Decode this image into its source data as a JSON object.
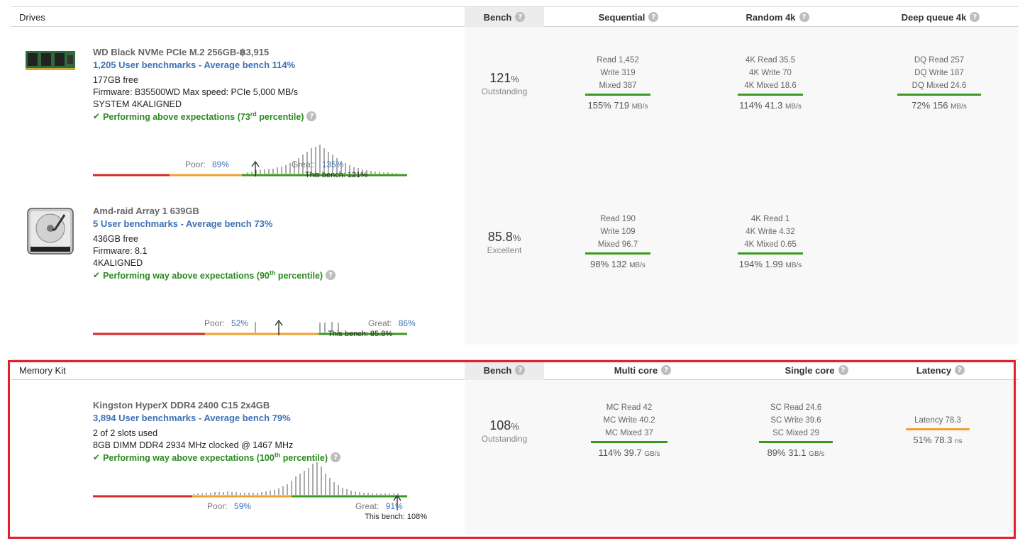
{
  "drives_section": {
    "title": "Drives",
    "columns": [
      "Bench",
      "Sequential",
      "Random 4k",
      "Deep queue 4k"
    ],
    "items": [
      {
        "name": "WD Black NVMe PCIe M.2 256GB-฿3,915",
        "user_link": "1,205 User benchmarks - Average bench 114%",
        "info": [
          "177GB free",
          "Firmware: B35500WD Max speed: PCIe 5,000 MB/s",
          "SYSTEM 4KALIGNED"
        ],
        "perf_text": "Performing above expectations (73",
        "perf_sup": "rd",
        "perf_end": " percentile)",
        "poor_label": "Poor:",
        "poor_value": "89%",
        "great_label": "Great:",
        "great_value": "135%",
        "this_bench": "This bench: 121%",
        "bench_num": "121",
        "bench_pct": "%",
        "bench_label": "Outstanding",
        "metrics": [
          {
            "lines": [
              "Read 1,452",
              "Write 319",
              "Mixed 387"
            ],
            "pct": "155%",
            "value": "719",
            "unit": "MB/s",
            "color": "#3a9a1f"
          },
          {
            "lines": [
              "4K Read 35.5",
              "4K Write 70",
              "4K Mixed 18.6"
            ],
            "pct": "114%",
            "value": "41.3",
            "unit": "MB/s",
            "color": "#3a9a1f"
          },
          {
            "lines": [
              "DQ Read 257",
              "DQ Write 187",
              "DQ Mixed 24.6"
            ],
            "pct": "72%",
            "value": "156",
            "unit": "MB/s",
            "color": "#3a9a1f"
          }
        ]
      },
      {
        "name": "Amd-raid Array 1 639GB",
        "user_link": "5 User benchmarks - Average bench 73%",
        "info": [
          "436GB free",
          "Firmware: 8.1",
          "4KALIGNED"
        ],
        "perf_text": "Performing way above expectations (90",
        "perf_sup": "th",
        "perf_end": " percentile)",
        "poor_label": "Poor:",
        "poor_value": "52%",
        "great_label": "Great:",
        "great_value": "86%",
        "this_bench": "This bench: 85.8%",
        "bench_num": "85.8",
        "bench_pct": "%",
        "bench_label": "Excellent",
        "metrics": [
          {
            "lines": [
              "Read 190",
              "Write 109",
              "Mixed 96.7"
            ],
            "pct": "98%",
            "value": "132",
            "unit": "MB/s",
            "color": "#3a9a1f"
          },
          {
            "lines": [
              "4K Read 1",
              "4K Write 4.32",
              "4K Mixed 0.65"
            ],
            "pct": "194%",
            "value": "1.99",
            "unit": "MB/s",
            "color": "#3a9a1f"
          }
        ]
      }
    ]
  },
  "memory_section": {
    "title": "Memory Kit",
    "columns": [
      "Bench",
      "Multi core",
      "Single core",
      "Latency"
    ],
    "item": {
      "name": "Kingston HyperX DDR4 2400 C15 2x4GB",
      "user_link": "3,894 User benchmarks - Average bench 79%",
      "info": [
        "2 of 2 slots used",
        "8GB DIMM DDR4 2934 MHz clocked @ 1467 MHz"
      ],
      "perf_text": "Performing way above expectations (100",
      "perf_sup": "th",
      "perf_end": " percentile)",
      "poor_label": "Poor:",
      "poor_value": "59%",
      "great_label": "Great:",
      "great_value": "91%",
      "this_bench": "This bench: 108%",
      "bench_num": "108",
      "bench_pct": "%",
      "bench_label": "Outstanding",
      "metrics": [
        {
          "lines": [
            "MC Read 42",
            "MC Write 40.2",
            "MC Mixed 37"
          ],
          "pct": "114%",
          "value": "39.7",
          "unit": "GB/s",
          "color": "#3a9a1f"
        },
        {
          "lines": [
            "SC Read 24.6",
            "SC Write 39.6",
            "SC Mixed 29"
          ],
          "pct": "89%",
          "value": "31.1",
          "unit": "GB/s",
          "color": "#3a9a1f"
        },
        {
          "lines": [
            "Latency 78.3"
          ],
          "pct": "51%",
          "value": "78.3",
          "unit": "ns",
          "color": "#f0a030"
        }
      ]
    }
  },
  "colors": {
    "poor": "#d42a2a",
    "average": "#f0a030",
    "great": "#3a9a1f",
    "highlight": "#e2202a"
  }
}
